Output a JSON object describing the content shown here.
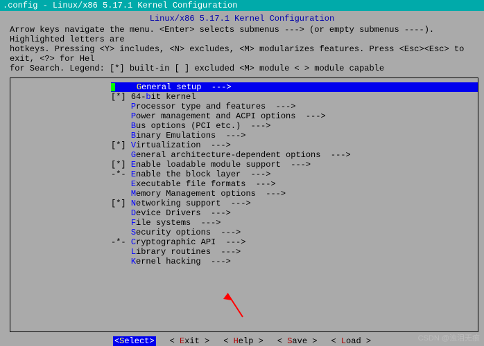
{
  "title": ".config - Linux/x86 5.17.1 Kernel Configuration",
  "heading": "Linux/x86 5.17.1 Kernel Configuration",
  "help_line1": "Arrow keys navigate the menu.  <Enter> selects submenus ---> (or empty submenus ----).  Highlighted letters are",
  "help_line2": "hotkeys.  Pressing <Y> includes, <N> excludes, <M> modularizes features.  Press <Esc><Esc> to exit, <?> for Hel",
  "help_line3": "for Search.  Legend: [*] built-in  [ ] excluded  <M> module  < > module capable",
  "menu": [
    {
      "prefix": "    ",
      "hot": "G",
      "rest": "eneral setup  --->",
      "selected": true
    },
    {
      "prefix": "[*] ",
      "plain": "64-",
      "hot": "b",
      "rest": "it kernel"
    },
    {
      "prefix": "    ",
      "hot": "P",
      "rest": "rocessor type and features  --->"
    },
    {
      "prefix": "    ",
      "hot": "P",
      "rest": "ower management and ACPI options  --->"
    },
    {
      "prefix": "    ",
      "hot": "B",
      "rest": "us options (PCI etc.)  --->"
    },
    {
      "prefix": "    ",
      "hot": "B",
      "rest": "inary Emulations  --->"
    },
    {
      "prefix": "[*] ",
      "hot": "V",
      "rest": "irtualization  --->"
    },
    {
      "prefix": "    ",
      "hot": "G",
      "rest": "eneral architecture-dependent options  --->"
    },
    {
      "prefix": "[*] ",
      "hot": "E",
      "rest": "nable loadable module support  --->"
    },
    {
      "prefix": "-*- ",
      "hot": "E",
      "rest": "nable the block layer  --->"
    },
    {
      "prefix": "    ",
      "hot": "E",
      "rest": "xecutable file formats  --->"
    },
    {
      "prefix": "    ",
      "hot": "M",
      "rest": "emory Management options  --->"
    },
    {
      "prefix": "[*] ",
      "hot": "N",
      "rest": "etworking support  --->"
    },
    {
      "prefix": "    ",
      "hot": "D",
      "rest": "evice Drivers  --->"
    },
    {
      "prefix": "    ",
      "hot": "F",
      "rest": "ile systems  --->"
    },
    {
      "prefix": "    ",
      "hot": "S",
      "rest": "ecurity options  --->"
    },
    {
      "prefix": "-*- ",
      "hot": "C",
      "rest": "ryptographic API  --->"
    },
    {
      "prefix": "    ",
      "hot": "L",
      "rest": "ibrary routines  --->"
    },
    {
      "prefix": "    ",
      "hot": "K",
      "rest": "ernel hacking  --->"
    }
  ],
  "buttons": {
    "select": {
      "open": "<",
      "hot": "S",
      "rest": "elect>",
      "selected": true
    },
    "exit": {
      "open": "< ",
      "hot": "E",
      "rest": "xit >"
    },
    "help": {
      "open": "< ",
      "hot": "H",
      "rest": "elp >"
    },
    "save": {
      "open": "< ",
      "hot": "S",
      "rest": "ave >"
    },
    "load": {
      "open": "< ",
      "hot": "L",
      "rest": "oad >"
    }
  },
  "watermark": "CSDN @浊泪无痕"
}
